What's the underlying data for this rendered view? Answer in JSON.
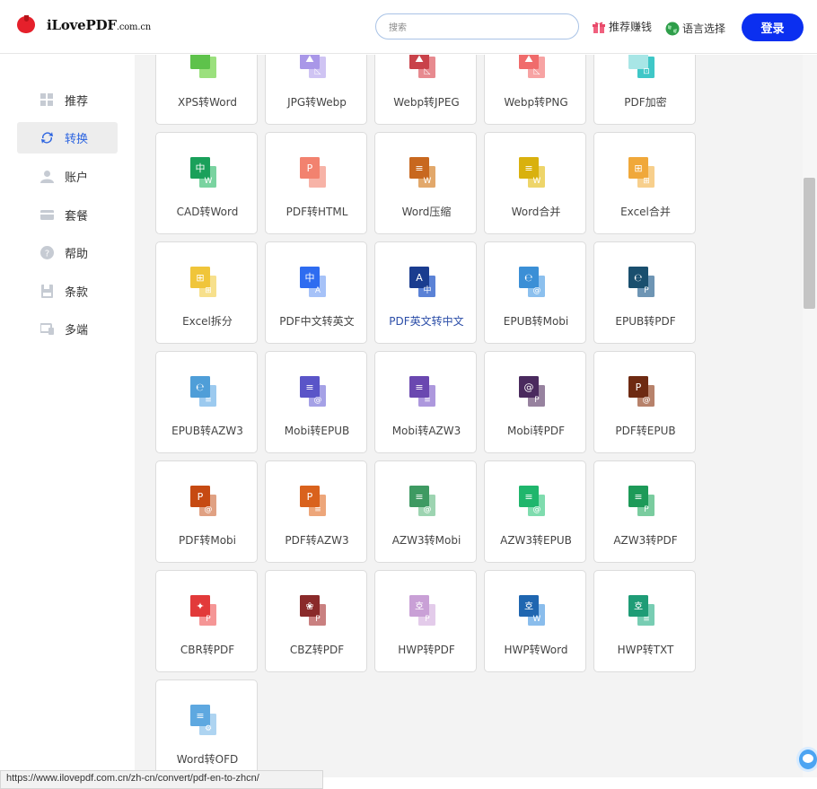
{
  "header": {
    "logo_main": "iLovePDF",
    "logo_suffix": ".com.cn",
    "search_placeholder": "搜索",
    "referral_label": "推荐赚钱",
    "language_label": "语言选择",
    "login_label": "登录"
  },
  "sidebar": {
    "items": [
      {
        "label": "推荐",
        "icon": "grid-icon"
      },
      {
        "label": "转换",
        "icon": "sync-icon",
        "active": true
      },
      {
        "label": "账户",
        "icon": "user-icon"
      },
      {
        "label": "套餐",
        "icon": "card-icon"
      },
      {
        "label": "帮助",
        "icon": "help-icon"
      },
      {
        "label": "条款",
        "icon": "save-icon"
      },
      {
        "label": "多端",
        "icon": "devices-icon"
      }
    ]
  },
  "tools": [
    {
      "label": "XPS转Word"
    },
    {
      "label": "JPG转Webp"
    },
    {
      "label": "Webp转JPEG"
    },
    {
      "label": "Webp转PNG"
    },
    {
      "label": "PDF加密"
    },
    {
      "label": "CAD转Word"
    },
    {
      "label": "PDF转HTML"
    },
    {
      "label": "Word压缩"
    },
    {
      "label": "Word合并"
    },
    {
      "label": "Excel合并"
    },
    {
      "label": "Excel拆分"
    },
    {
      "label": "PDF中文转英文"
    },
    {
      "label": "PDF英文转中文"
    },
    {
      "label": "EPUB转Mobi"
    },
    {
      "label": "EPUB转PDF"
    },
    {
      "label": "EPUB转AZW3"
    },
    {
      "label": "Mobi转EPUB"
    },
    {
      "label": "Mobi转AZW3"
    },
    {
      "label": "Mobi转PDF"
    },
    {
      "label": "PDF转EPUB"
    },
    {
      "label": "PDF转Mobi"
    },
    {
      "label": "PDF转AZW3"
    },
    {
      "label": "AZW3转Mobi"
    },
    {
      "label": "AZW3转EPUB"
    },
    {
      "label": "AZW3转PDF"
    },
    {
      "label": "CBR转PDF"
    },
    {
      "label": "CBZ转PDF"
    },
    {
      "label": "HWP转PDF"
    },
    {
      "label": "HWP转Word"
    },
    {
      "label": "HWP转TXT"
    },
    {
      "label": "Word转OFD"
    }
  ],
  "status_url": "https://www.ilovepdf.com.cn/zh-cn/convert/pdf-en-to-zhcn/"
}
